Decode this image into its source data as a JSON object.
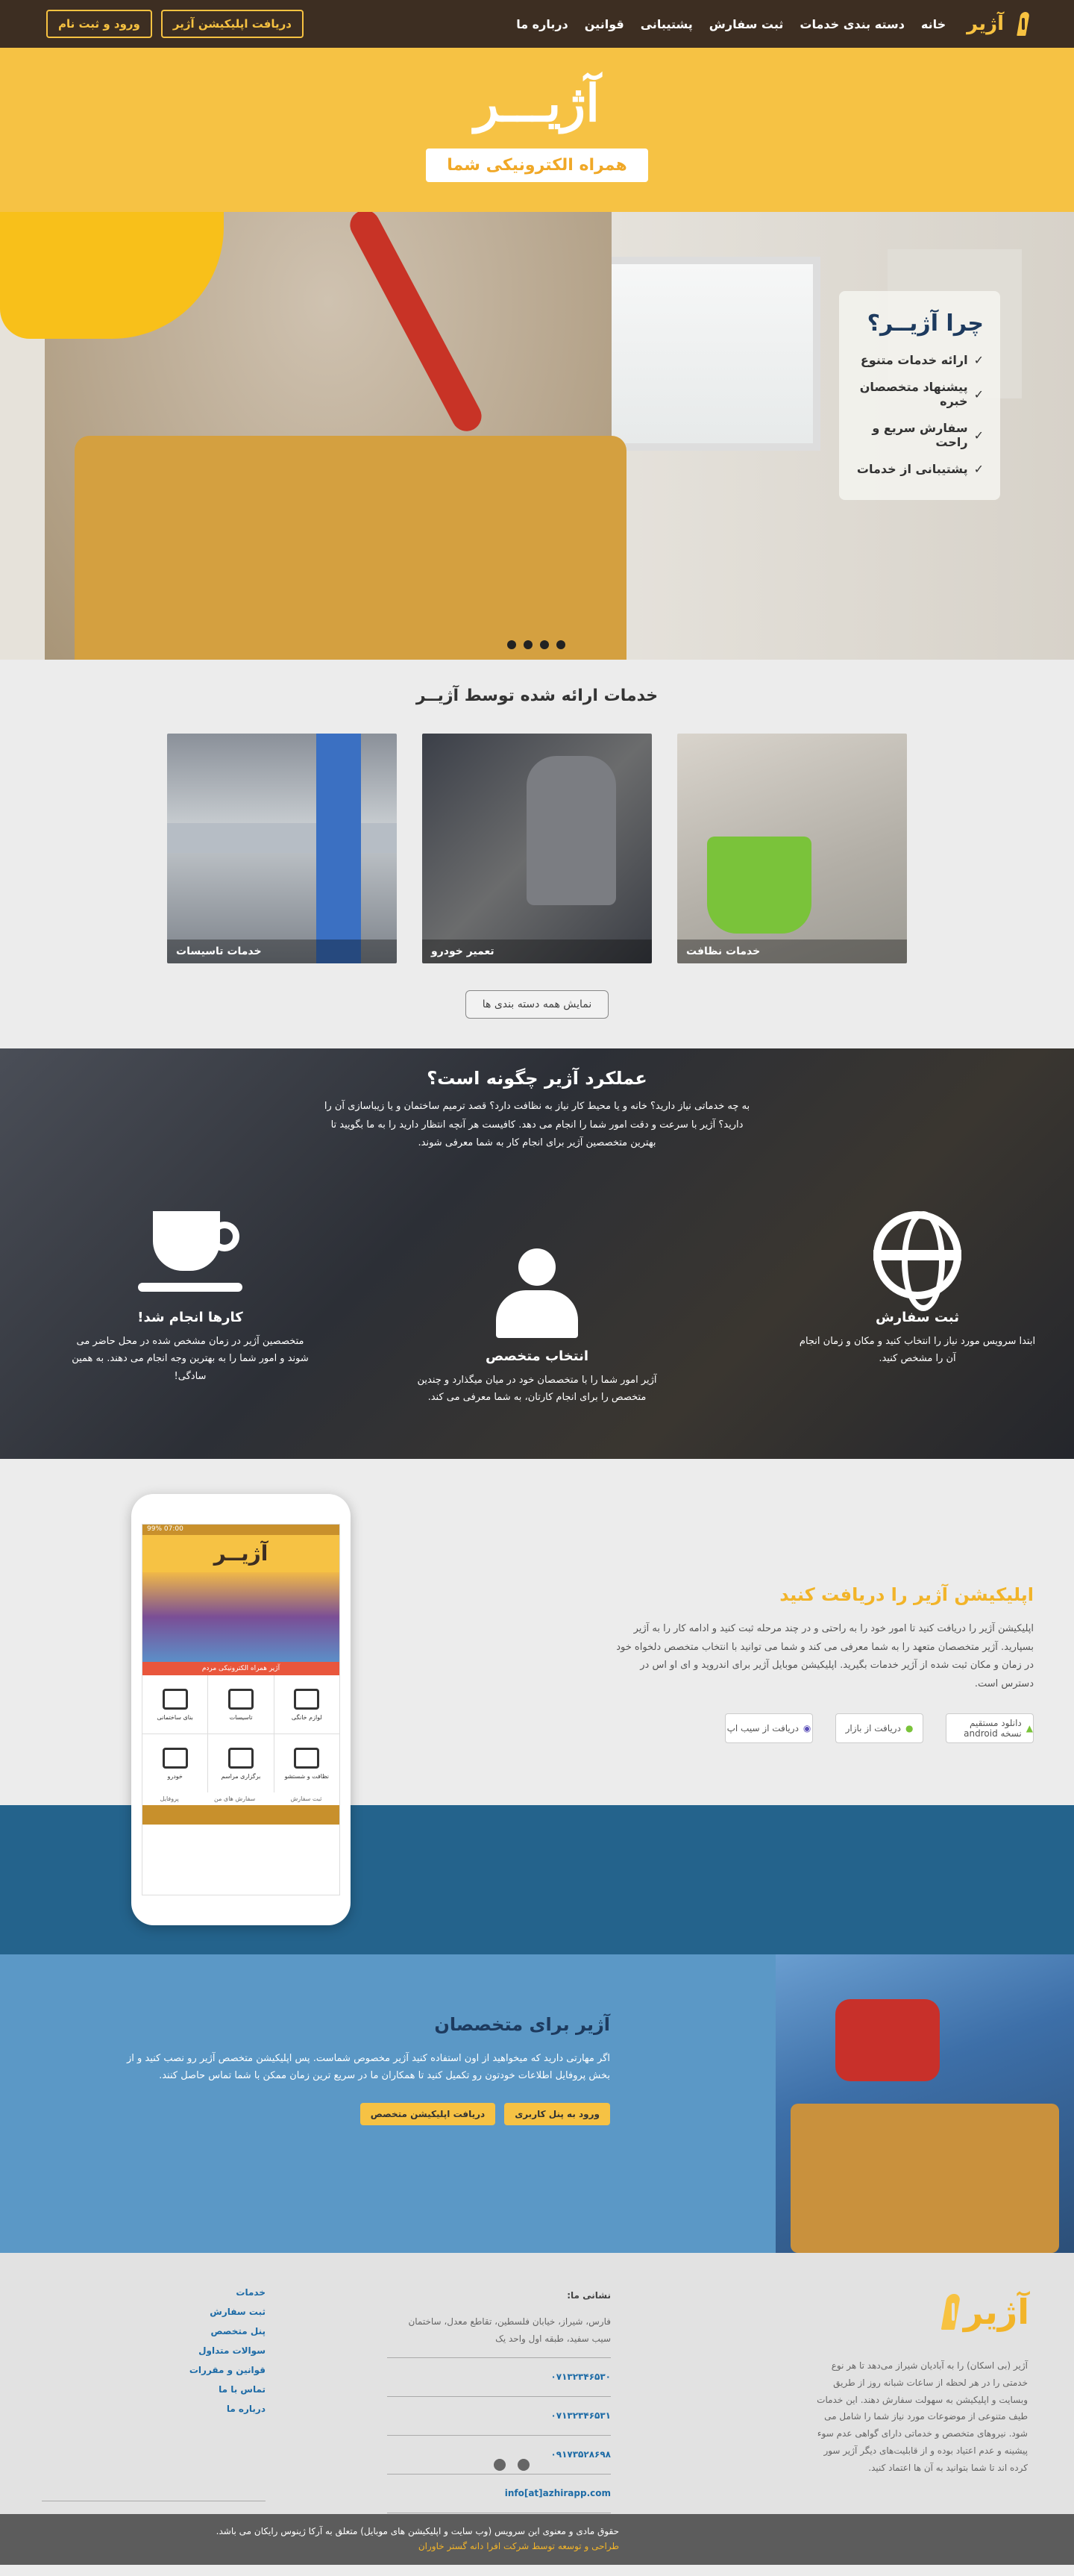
{
  "nav": {
    "logo": "آژیر",
    "menu": [
      "خانه",
      "دسته بندی خدمات",
      "ثبت سفارش",
      "پشتیبانی",
      "قوانین",
      "درباره ما"
    ],
    "download_btn": "دریافت اپلیکیشن آژیر",
    "login_btn": "ورود و ثبت نام"
  },
  "banner": {
    "title": "آژیـــر",
    "tagline": "همراه الکترونیکی شما"
  },
  "slider": {
    "why_title": "چرا آژیــر؟",
    "why_items": [
      "ارائه خدمات متنوع",
      "پیشنهاد متخصصان خبره",
      "سفارش سریع و راحت",
      "پشتیبانی از خدمات"
    ]
  },
  "services": {
    "title": "خدمات ارائه شده توسط آژیــر",
    "items": [
      "خدمات نظافت",
      "تعمیر خودرو",
      "خدمات تاسیسات"
    ],
    "all_btn": "نمایش همه دسته بندی ها"
  },
  "how": {
    "title": "عملکرد آژیر چگونه است؟",
    "intro": "به چه خدماتی نیاز دارید؟ خانه و یا محیط کار نیاز به نظافت دارد؟ قصد ترمیم ساختمان و یا زیباسازی آن را دارید؟ آژیر با سرعت و دقت امور شما را انجام می دهد. کافیست هر آنچه انتظار دارید را به ما بگویید تا بهترین متخصصین آژیر برای انجام کار به شما معرفی شوند.",
    "steps": [
      {
        "title": "ثبت سفارش",
        "text": "ابتدا سرویس مورد نیاز را انتخاب کنید و مکان و زمان انجام آن را مشخص کنید."
      },
      {
        "title": "انتخاب متخصص",
        "text": "آژیر امور شما را با متخصصان خود در میان میگذارد و چندین متخصص را برای انجام کارتان، به شما معرفی می کند."
      },
      {
        "title": "کارها انجام شد!",
        "text": "متخصصین آژیر در زمان مشخص شده در محل حاضر می شوند و امور شما را به بهترین وجه انجام می دهند. به همین سادگی!"
      }
    ]
  },
  "app": {
    "title": "اپلیکیشن آژیر را دریافت کنید",
    "text": "اپلیکیشن آژیر را دریافت کنید تا امور خود را به راحتی و در چند مرحله ثبت کنید و ادامه کار را به آژیر بسپارید. آژیر متخصصان متعهد را به شما معرفی می کند و شما می توانید با انتخاب متخصص دلخواه خود در زمان و مکان ثبت شده از آژیر خدمات بگیرید. اپلیکیشن موبایل آژیر برای اندروید و ای او اس در دسترس است.",
    "stores": [
      "دانلود مستقیم نسخه android",
      "دریافت از بازار",
      "دریافت از سیب اپ"
    ],
    "phone": {
      "status": "07:00 99%",
      "logo": "آژیــر",
      "ribbon": "آژیر همراه الکترونیکی مردم",
      "cells": [
        "لوازم خانگی",
        "تاسیسات",
        "بنای ساختمانی",
        "نظافت و شستشو",
        "برگزاری مراسم",
        "خودرو"
      ],
      "tabs": [
        "ثبت سفارش",
        "سفارش های من",
        "پروفایل"
      ]
    }
  },
  "experts": {
    "title": "آژیر برای متخصصان",
    "text": "اگر مهارتی دارید که میخواهید از اون استفاده کنید آژیر مخصوص شماست. پس اپلیکیشن متخصص آژیر رو نصب کنید و از بخش پروفایل اطلاعات خودتون رو تکمیل کنید تا همکاران ما در سریع ترین زمان ممکن با شما تماس حاصل کنند.",
    "panel_btn": "ورود به پنل کاربری",
    "app_btn": "دریافت اپلیکیشن متخصص"
  },
  "footer": {
    "logo": "آژیر",
    "about": "آژیر (بی اسکان) را به آبادیان شیراز می‌دهد تا هر نوع خدمتی را در هر لحظه از ساعات شبانه روز از طریق وبسایت و اپلیکیشن به سهولت سفارش دهند. این خدمات طیف متنوعی از موضوعات مورد نیاز شما را شامل می شود. نیروهای متخصص و خدماتی دارای گواهی عدم سوء پیشینه و عدم اعتیاد بوده و از قابلیت‌های دیگر آژیر سور کرده اند تا شما بتوانید به آن ها اعتماد کنید.",
    "address_title": "نشانی ما:",
    "address": "فارس، شیراز، خیابان فلسطین، تقاطع معدل، ساختمان سیب سفید، طبقه اول واحد یک",
    "phones": [
      "۰۷۱۳۲۳۴۶۵۳۰",
      "۰۷۱۳۲۳۴۶۵۳۱",
      "۰۹۱۷۳۵۲۸۶۹۸"
    ],
    "email": "info[at]azhirapp.com",
    "links": [
      "خدمات",
      "ثبت سفارش",
      "پنل متخصص",
      "سوالات متداول",
      "قوانین و مقررات",
      "تماس با ما",
      "درباره ما"
    ],
    "copyright": "حقوق مادی و معنوی این سرویس (وب سایت و اپلیکیشن های موبایل) متعلق به آرکا ژینوس رایکان می باشد.",
    "credit": "طراحی و توسعه توسط شرکت افرا دانه گستر خاوران"
  }
}
